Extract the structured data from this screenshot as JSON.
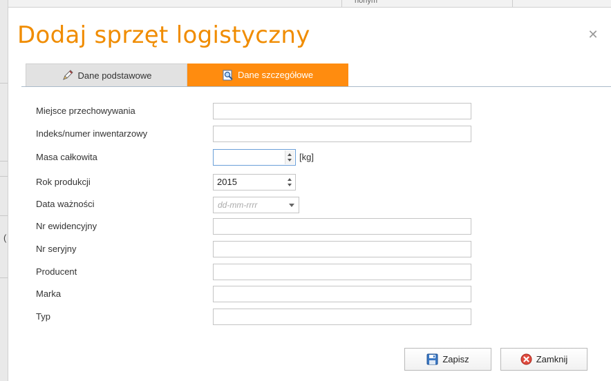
{
  "background": {
    "top_text": "nonym"
  },
  "dialog": {
    "title": "Dodaj sprzęt logistyczny",
    "close_icon": "close-icon",
    "tabs": [
      {
        "label": "Dane podstawowe",
        "icon": "pencil-icon",
        "active": false
      },
      {
        "label": "Dane szczegółowe",
        "icon": "search-document-icon",
        "active": true
      }
    ],
    "fields": {
      "storage_place": {
        "label": "Miejsce przechowywania",
        "value": ""
      },
      "inventory_index": {
        "label": "Indeks/numer inwentarzowy",
        "value": ""
      },
      "total_mass": {
        "label": "Masa całkowita",
        "value": "",
        "unit": "[kg]"
      },
      "production_year": {
        "label": "Rok produkcji",
        "value": "2015"
      },
      "expiry_date": {
        "label": "Data ważności",
        "placeholder": "dd-mm-rrrr"
      },
      "registry_number": {
        "label": "Nr ewidencyjny",
        "value": ""
      },
      "serial_number": {
        "label": "Nr seryjny",
        "value": ""
      },
      "producer": {
        "label": "Producent",
        "value": ""
      },
      "brand": {
        "label": "Marka",
        "value": ""
      },
      "type": {
        "label": "Typ",
        "value": ""
      }
    },
    "buttons": {
      "save": {
        "label": "Zapisz",
        "icon": "floppy-disk-icon"
      },
      "close": {
        "label": "Zamknij",
        "icon": "red-x-icon"
      }
    }
  },
  "colors": {
    "accent": "#f08c00",
    "tab_active": "#ff8c0f",
    "tab_inactive": "#e2e2e2"
  }
}
